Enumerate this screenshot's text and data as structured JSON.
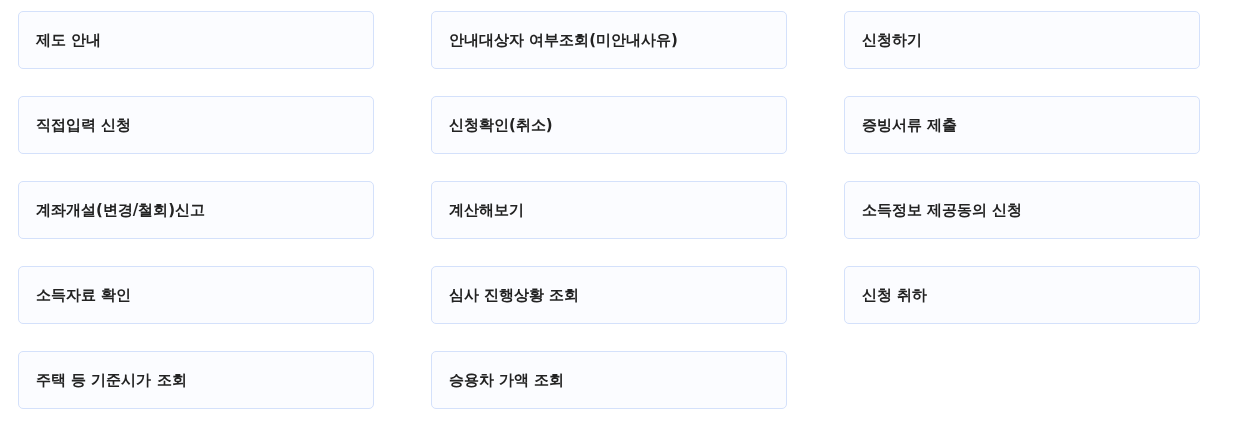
{
  "menu_items": [
    {
      "label": "제도 안내"
    },
    {
      "label": "안내대상자 여부조회(미안내사유)"
    },
    {
      "label": "신청하기"
    },
    {
      "label": "직접입력 신청"
    },
    {
      "label": "신청확인(취소)"
    },
    {
      "label": "증빙서류 제출"
    },
    {
      "label": "계좌개설(변경/철회)신고"
    },
    {
      "label": "계산해보기"
    },
    {
      "label": "소득정보 제공동의 신청"
    },
    {
      "label": "소득자료 확인"
    },
    {
      "label": "심사 진행상황 조회"
    },
    {
      "label": "신청 취하"
    },
    {
      "label": "주택 등 기준시가 조회"
    },
    {
      "label": "승용차 가액 조회"
    }
  ]
}
